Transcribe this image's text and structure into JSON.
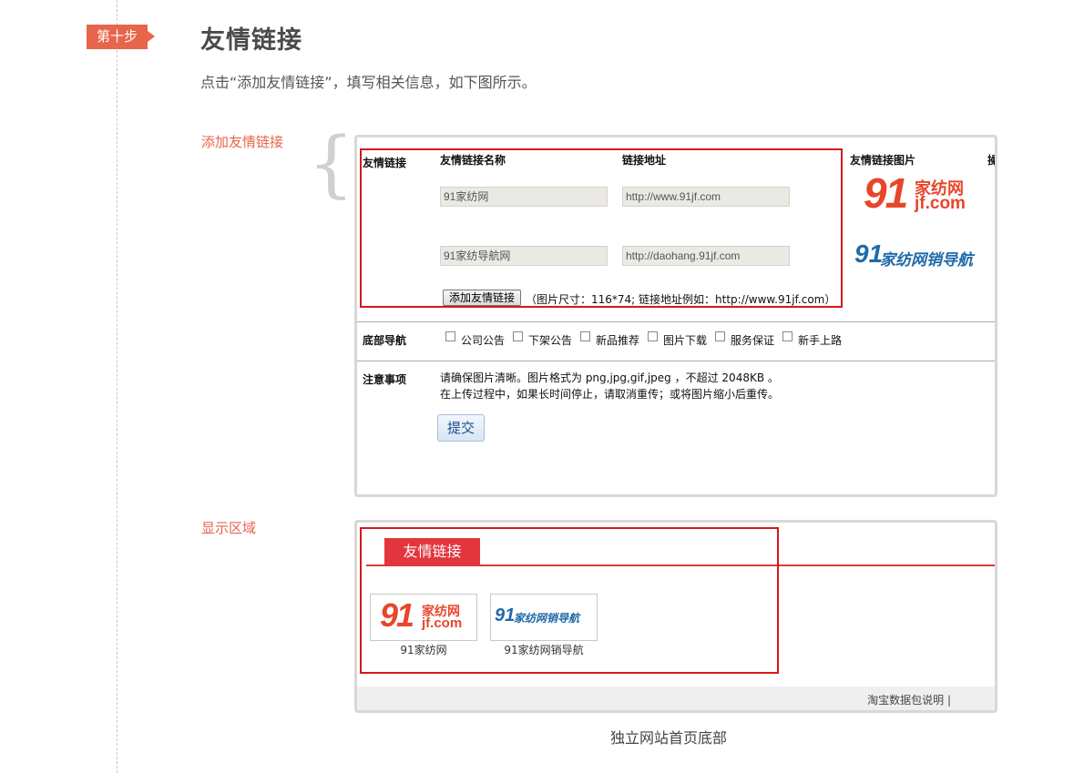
{
  "step": {
    "badge": "第十步",
    "title": "友情链接",
    "description": "点击“添加友情链接”，填写相关信息，如下图所示。"
  },
  "labels": {
    "add_section": "添加友情链接",
    "display_section": "显示区域"
  },
  "form": {
    "row_label": "友情链接",
    "col_name": "友情链接名称",
    "col_url": "链接地址",
    "col_image": "友情链接图片",
    "col_extra": "操",
    "links": [
      {
        "name": "91家纺网",
        "url": "http://www.91jf.com"
      },
      {
        "name": "91家纺导航网",
        "url": "http://daohang.91jf.com"
      }
    ],
    "logo1": {
      "number": "91",
      "top": "家纺网",
      "bottom": "jf.com"
    },
    "logo2": {
      "number": "91",
      "text": "家纺网销导航"
    },
    "add_button": "添加友情链接",
    "size_hint": "（图片尺寸：116*74; 链接地址例如：http://www.91jf.com）",
    "footer_nav_label": "底部导航",
    "footer_nav_options": [
      "公司公告",
      "下架公告",
      "新品推荐",
      "图片下载",
      "服务保证",
      "新手上路"
    ],
    "notice_label": "注意事项",
    "notice_lines": [
      "请确保图片清晰。图片格式为 png,jpg,gif,jpeg ，不超过 2048KB 。",
      "在上传过程中，如果长时间停止，请取消重传；或将图片缩小后重传。"
    ],
    "submit": "提交"
  },
  "display": {
    "tab": "友情链接",
    "items": [
      {
        "caption": "91家纺网"
      },
      {
        "caption": "91家纺网销导航"
      }
    ],
    "footer": "淘宝数据包说明 |"
  },
  "caption": "独立网站首页底部",
  "colors": {
    "accent": "#e8644a",
    "red": "#d9161c",
    "tab_red": "#e3353d",
    "logo_blue": "#1f6aa8"
  }
}
